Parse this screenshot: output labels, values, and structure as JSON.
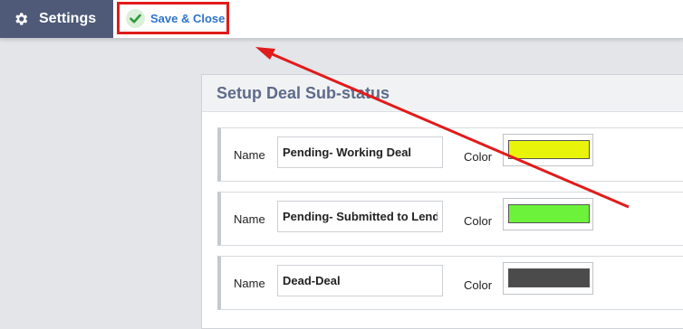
{
  "topbar": {
    "settings_label": "Settings",
    "settings_icon": "gear-icon",
    "save_close_label": "Save & Close",
    "save_icon": "check-icon"
  },
  "panel": {
    "title": "Setup Deal Sub-status"
  },
  "statuses": [
    {
      "name_label": "Name",
      "name_value": "Pending- Working Deal",
      "color_label": "Color",
      "color": "#e8f50a"
    },
    {
      "name_label": "Name",
      "name_value": "Pending- Submitted to Lend",
      "color_label": "Color",
      "color": "#6cf23a"
    },
    {
      "name_label": "Name",
      "name_value": "Dead-Deal",
      "color_label": "Color",
      "color": "#4b4b4b"
    }
  ],
  "colors": {
    "nav_bg": "#4f5a78",
    "highlight_border": "#e11b1b",
    "save_text": "#2d73c9",
    "check": "#2f9a3a"
  }
}
